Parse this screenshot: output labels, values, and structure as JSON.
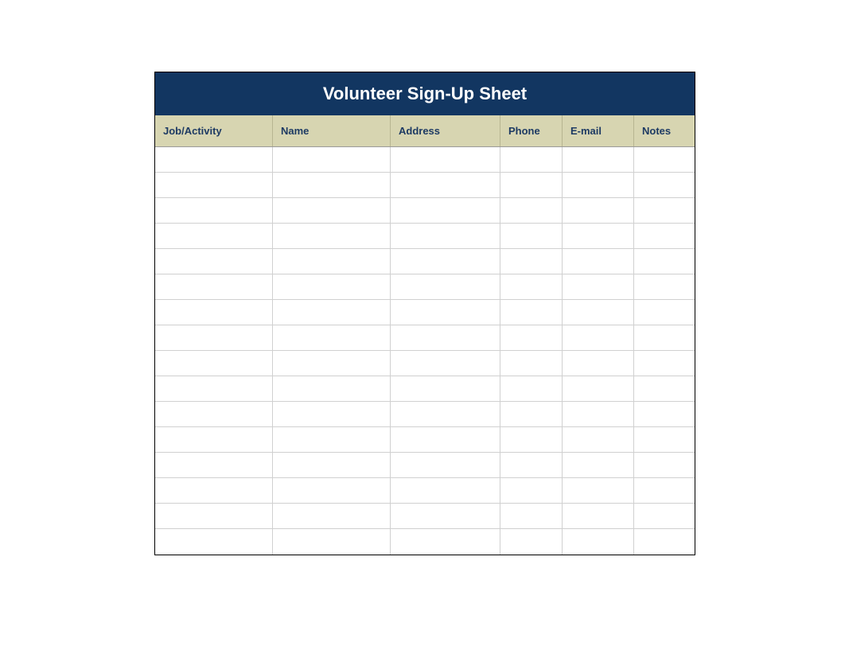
{
  "title": "Volunteer Sign-Up Sheet",
  "columns": {
    "activity": "Job/Activity",
    "name": "Name",
    "address": "Address",
    "phone": "Phone",
    "email": "E-mail",
    "notes": "Notes"
  },
  "row_count": 16,
  "rows": [
    {
      "activity": "",
      "name": "",
      "address": "",
      "phone": "",
      "email": "",
      "notes": ""
    },
    {
      "activity": "",
      "name": "",
      "address": "",
      "phone": "",
      "email": "",
      "notes": ""
    },
    {
      "activity": "",
      "name": "",
      "address": "",
      "phone": "",
      "email": "",
      "notes": ""
    },
    {
      "activity": "",
      "name": "",
      "address": "",
      "phone": "",
      "email": "",
      "notes": ""
    },
    {
      "activity": "",
      "name": "",
      "address": "",
      "phone": "",
      "email": "",
      "notes": ""
    },
    {
      "activity": "",
      "name": "",
      "address": "",
      "phone": "",
      "email": "",
      "notes": ""
    },
    {
      "activity": "",
      "name": "",
      "address": "",
      "phone": "",
      "email": "",
      "notes": ""
    },
    {
      "activity": "",
      "name": "",
      "address": "",
      "phone": "",
      "email": "",
      "notes": ""
    },
    {
      "activity": "",
      "name": "",
      "address": "",
      "phone": "",
      "email": "",
      "notes": ""
    },
    {
      "activity": "",
      "name": "",
      "address": "",
      "phone": "",
      "email": "",
      "notes": ""
    },
    {
      "activity": "",
      "name": "",
      "address": "",
      "phone": "",
      "email": "",
      "notes": ""
    },
    {
      "activity": "",
      "name": "",
      "address": "",
      "phone": "",
      "email": "",
      "notes": ""
    },
    {
      "activity": "",
      "name": "",
      "address": "",
      "phone": "",
      "email": "",
      "notes": ""
    },
    {
      "activity": "",
      "name": "",
      "address": "",
      "phone": "",
      "email": "",
      "notes": ""
    },
    {
      "activity": "",
      "name": "",
      "address": "",
      "phone": "",
      "email": "",
      "notes": ""
    },
    {
      "activity": "",
      "name": "",
      "address": "",
      "phone": "",
      "email": "",
      "notes": ""
    }
  ]
}
